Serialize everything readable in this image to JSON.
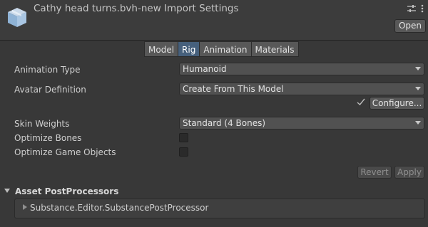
{
  "header": {
    "title": "Cathy head turns.bvh-new Import Settings",
    "open_label": "Open",
    "icons": [
      "asset-file-icon",
      "presets-icon",
      "more-options-icon"
    ]
  },
  "tabs": [
    {
      "label": "Model",
      "active": false
    },
    {
      "label": "Rig",
      "active": true
    },
    {
      "label": "Animation",
      "active": false
    },
    {
      "label": "Materials",
      "active": false
    }
  ],
  "rig": {
    "animation_type": {
      "label": "Animation Type",
      "value": "Humanoid"
    },
    "avatar_definition": {
      "label": "Avatar Definition",
      "value": "Create From This Model"
    },
    "configure_label": "Configure...",
    "skin_weights": {
      "label": "Skin Weights",
      "value": "Standard (4 Bones)"
    },
    "optimize_bones": {
      "label": "Optimize Bones",
      "checked": false
    },
    "optimize_game_objects": {
      "label": "Optimize Game Objects",
      "checked": false
    }
  },
  "actions": {
    "revert_label": "Revert",
    "apply_label": "Apply"
  },
  "postprocessors": {
    "title": "Asset PostProcessors",
    "items": [
      "Substance.Editor.SubstancePostProcessor"
    ]
  },
  "colors": {
    "background": "#383838",
    "active_tab": "#46607c"
  }
}
